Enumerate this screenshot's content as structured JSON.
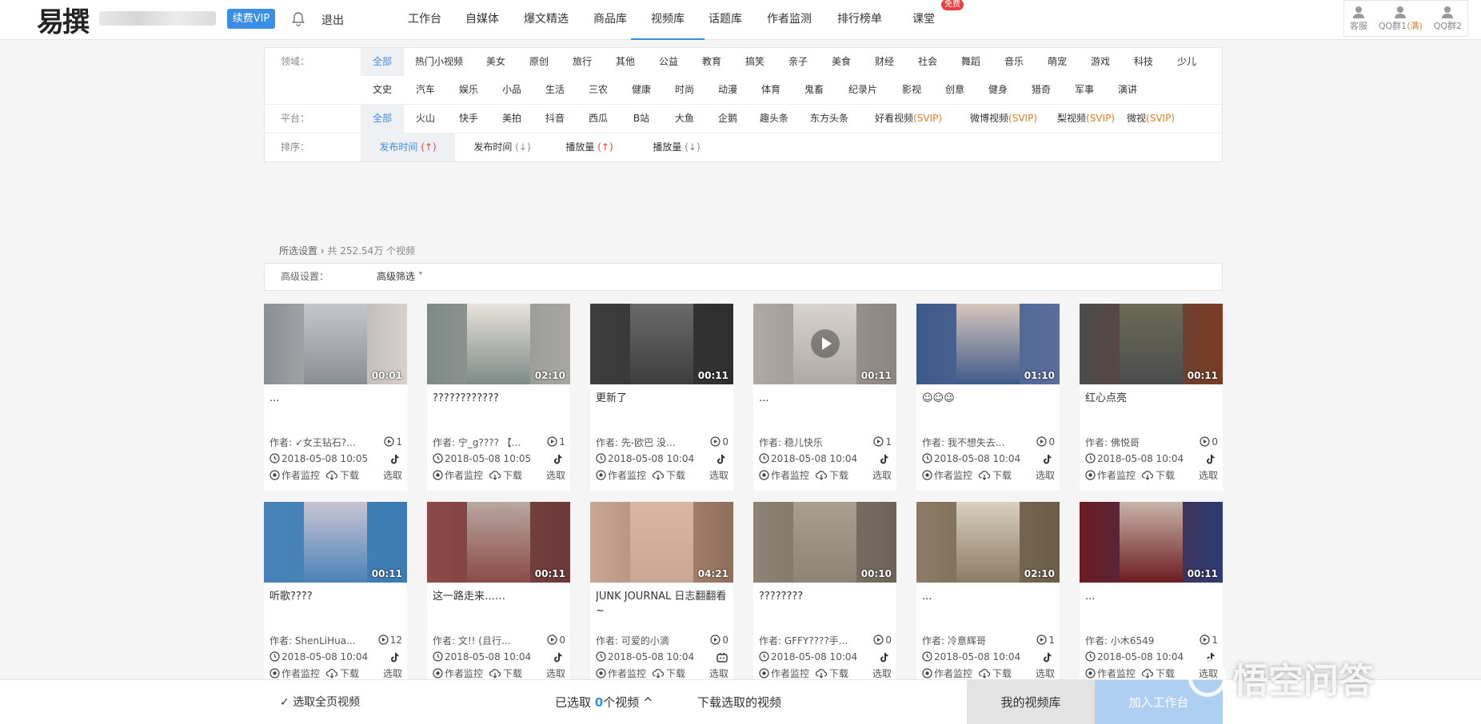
{
  "header": {
    "logo_text": "易撰",
    "vip_label": "续费VIP",
    "logout_label": "退出",
    "nav": [
      {
        "label": "工作台"
      },
      {
        "label": "自媒体"
      },
      {
        "label": "爆文精选"
      },
      {
        "label": "商品库"
      },
      {
        "label": "视频库",
        "active": true
      },
      {
        "label": "话题库"
      },
      {
        "label": "作者监测"
      },
      {
        "label": "排行榜单"
      },
      {
        "label": "课堂",
        "badge": "免费"
      }
    ],
    "tools": [
      {
        "label": "客服",
        "icon": "support-icon"
      },
      {
        "label": "QQ群1",
        "extra": "(满)",
        "icon": "qq-group-icon"
      },
      {
        "label": "QQ群2",
        "icon": "qq-group-icon"
      }
    ]
  },
  "filters": {
    "domain": {
      "label": "领域：",
      "options": [
        "全部",
        "热门小视频",
        "美女",
        "原创",
        "旅行",
        "其他",
        "公益",
        "教育",
        "搞笑",
        "亲子",
        "美食",
        "财经",
        "社会",
        "舞蹈",
        "音乐",
        "萌宠",
        "游戏",
        "科技",
        "少儿",
        "文史",
        "汽车",
        "娱乐",
        "小品",
        "生活",
        "三农",
        "健康",
        "时尚",
        "动漫",
        "体育",
        "鬼畜",
        "纪录片",
        "影视",
        "创意",
        "健身",
        "猎奇",
        "军事",
        "演讲"
      ]
    },
    "platform": {
      "label": "平台：",
      "options": [
        {
          "text": "全部"
        },
        {
          "text": "火山"
        },
        {
          "text": "快手"
        },
        {
          "text": "美拍"
        },
        {
          "text": "抖音"
        },
        {
          "text": "西瓜"
        },
        {
          "text": "B站"
        },
        {
          "text": "大鱼"
        },
        {
          "text": "企鹅"
        },
        {
          "text": "趣头条"
        },
        {
          "text": "东方头条"
        },
        {
          "text": "好看视频",
          "svip": "(SVIP)"
        },
        {
          "text": "微博视频",
          "svip": "(SVIP)"
        },
        {
          "text": "梨视频",
          "svip": "(SVIP)"
        },
        {
          "text": "微视",
          "svip": "(SVIP)"
        }
      ]
    },
    "sort": {
      "label": "排序：",
      "options": [
        {
          "text": "发布时间",
          "arrow": "(↑)"
        },
        {
          "text": "发布时间",
          "arrow": "(↓)"
        },
        {
          "text": "播放量",
          "arrow": "(↑)"
        },
        {
          "text": "播放量",
          "arrow": "(↓)"
        }
      ]
    }
  },
  "breadcrumb": {
    "text": "所选设置",
    "count": "共 252.54万 个视频"
  },
  "advanced": {
    "label": "高级设置：",
    "value": "高级筛选"
  },
  "cards": [
    {
      "title": "...",
      "duration": "00:01",
      "author": "作者: ✓女王钻石?...",
      "plays": "1",
      "date": "2018-05-08 10:05",
      "colors": [
        "#8a8f95",
        "#c4c8cc",
        "#d9d0cc"
      ]
    },
    {
      "title": "????????????",
      "duration": "02:10",
      "author": "作者: 宁_g???? 【...",
      "plays": "1",
      "date": "2018-05-08 10:05",
      "colors": [
        "#7e8a86",
        "#e8e2dc",
        "#a9a6a2"
      ]
    },
    {
      "title": "更新了",
      "duration": "00:11",
      "author": "作者: 先-欧巴 没...",
      "plays": "0",
      "date": "2018-05-08 10:04",
      "colors": [
        "#3e3e3e",
        "#6a6a6a",
        "#2e2e2e"
      ]
    },
    {
      "title": "...",
      "duration": "00:11",
      "author": "作者: 稳儿快乐",
      "plays": "1",
      "date": "2018-05-08 10:04",
      "colors": [
        "#b0a9a3",
        "#d8d3ce",
        "#8c8580"
      ],
      "play": true
    },
    {
      "title": "☺☺☺",
      "duration": "01:10",
      "author": "作者: 我不想失去...",
      "plays": "0",
      "date": "2018-05-08 10:04",
      "colors": [
        "#3e5a8a",
        "#d7c6bc",
        "#5a6e9c"
      ]
    },
    {
      "title": "红心点亮",
      "duration": "00:11",
      "author": "作者: 佛悦哥",
      "plays": "0",
      "date": "2018-05-08 10:04",
      "colors": [
        "#4a4c4e",
        "#6d6b55",
        "#7a3c24"
      ]
    },
    {
      "title": "听歌????",
      "duration": "00:11",
      "author": "作者: ShenLiHua...",
      "plays": "12",
      "date": "2018-05-08 10:04",
      "colors": [
        "#4a83b8",
        "#c9c4d2",
        "#3c7bb4"
      ]
    },
    {
      "title": "这一路走来……",
      "duration": "00:11",
      "author": "作者: 文!! (且行...",
      "plays": "0",
      "date": "2018-05-08 10:04",
      "colors": [
        "#8c4a48",
        "#b8a8a0",
        "#6a3a38"
      ]
    },
    {
      "title": "JUNK JOURNAL 日志翻翻看~",
      "duration": "04:21",
      "author": "作者: 可爱的小滴",
      "plays": "0",
      "date": "2018-05-08 10:04",
      "colors": [
        "#c8a894",
        "#d9b6a0",
        "#8f6e5a"
      ],
      "bili": true
    },
    {
      "title": "????????",
      "duration": "00:10",
      "author": "作者: GFFY????手...",
      "plays": "0",
      "date": "2018-05-08 10:04",
      "colors": [
        "#8d8474",
        "#a8a08e",
        "#6c6458"
      ]
    },
    {
      "title": "...",
      "duration": "02:10",
      "author": "作者: 冷意辉哥",
      "plays": "1",
      "date": "2018-05-08 10:04",
      "colors": [
        "#8c7c64",
        "#d8d0c0",
        "#6c5c48"
      ]
    },
    {
      "title": "...",
      "duration": "00:11",
      "author": "作者: 小木6549",
      "plays": "1",
      "date": "2018-05-08 10:04",
      "colors": [
        "#6c1c20",
        "#c8b4a8",
        "#2c3c74"
      ]
    }
  ],
  "card_actions": {
    "monitor": "作者监控",
    "download": "下载",
    "select": "选取"
  },
  "bottom": {
    "select_all": "选取全页视频",
    "selected_prefix": "已选取",
    "selected_count": "0",
    "selected_suffix": "个视频",
    "download_selected": "下载选取的视频",
    "my_library": "我的视频库",
    "add_workspace": "加入工作台"
  },
  "watermark": "悟空问答"
}
